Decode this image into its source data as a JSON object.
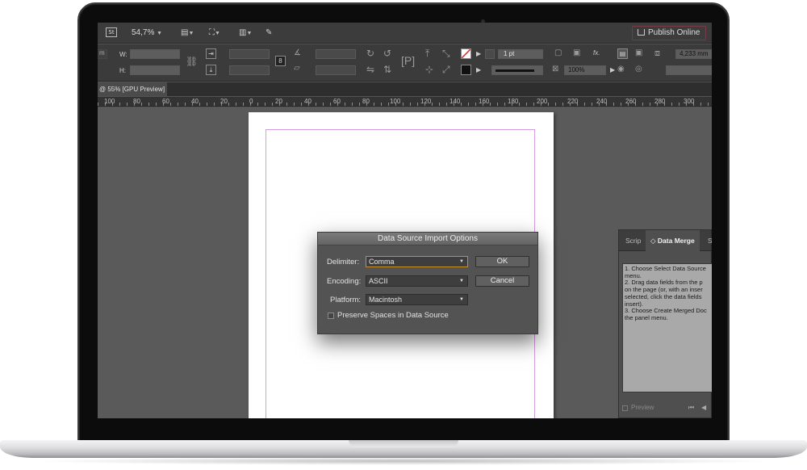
{
  "appbar": {
    "stock_badge": "St",
    "zoom": "54,7%",
    "publish_label": "Publish Online"
  },
  "control_panel": {
    "partial_label": "m",
    "w_label": "W:",
    "h_label": "H:",
    "stroke_weight": "1 pt",
    "scale_percent": "100%",
    "dimension": "4,233 mm",
    "fx_label": "fx."
  },
  "document_tab": {
    "label": "@ 55% [GPU Preview]"
  },
  "ruler": {
    "labels": [
      "100",
      "80",
      "60",
      "40",
      "20",
      "0",
      "20",
      "40",
      "60",
      "80",
      "100",
      "120",
      "140",
      "160",
      "180",
      "200",
      "220",
      "240",
      "260",
      "280",
      "300"
    ]
  },
  "dialog": {
    "title": "Data Source Import Options",
    "delimiter_label": "Delimiter:",
    "delimiter_value": "Comma",
    "encoding_label": "Encoding:",
    "encoding_value": "ASCII",
    "platform_label": "Platform:",
    "platform_value": "Macintosh",
    "preserve_spaces_label": "Preserve Spaces in Data Source",
    "ok_label": "OK",
    "cancel_label": "Cancel"
  },
  "panel": {
    "tab_scripts": "Scrip",
    "tab_data_merge": "Data Merge",
    "tab_next": "S",
    "instructions": [
      "1. Choose Select Data Source",
      "menu.",
      "2. Drag data fields from the p",
      "on the page (or, with an inser",
      "selected, click the data fields",
      "insert).",
      "3. Choose Create Merged Doc",
      "the panel menu."
    ],
    "preview_label": "Preview"
  },
  "colors": {
    "accent_focus": "#c7902a",
    "margin_guide": "#d49be0",
    "publish_border": "#7a3a45"
  }
}
